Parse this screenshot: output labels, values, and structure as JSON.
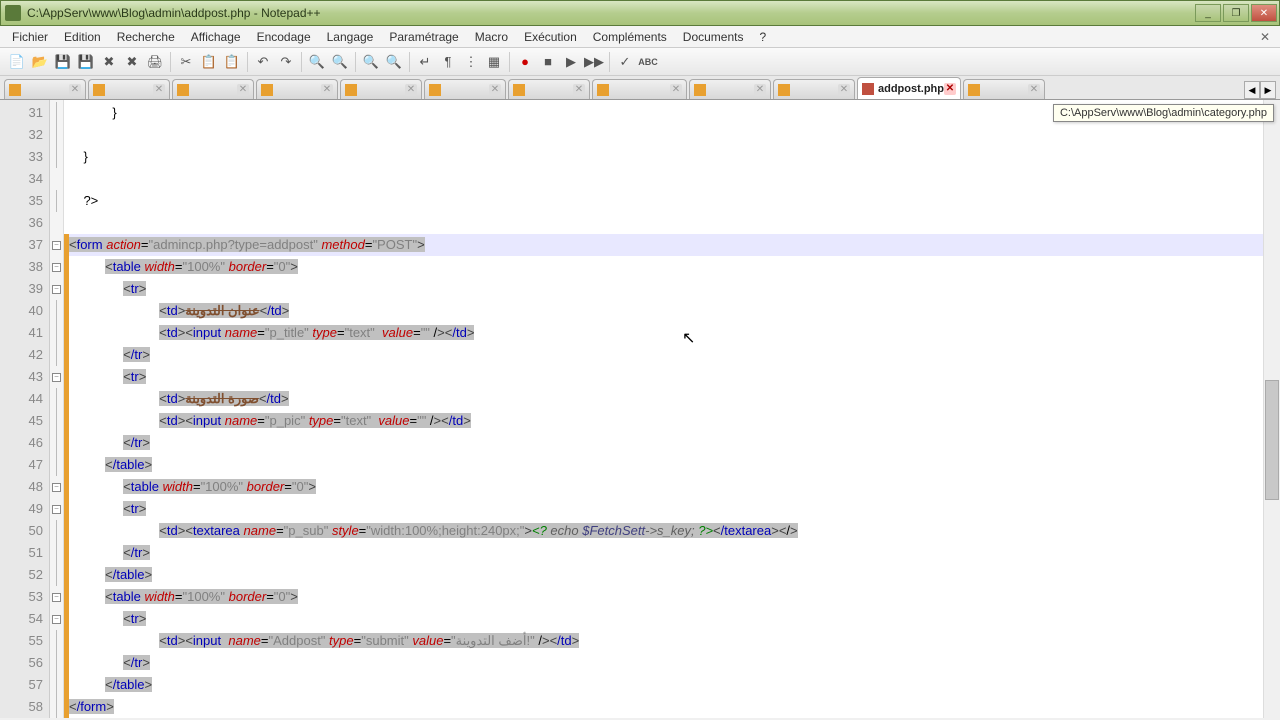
{
  "window": {
    "title": "C:\\AppServ\\www\\Blog\\admin\\addpost.php - Notepad++"
  },
  "menu": {
    "items": [
      "Fichier",
      "Edition",
      "Recherche",
      "Affichage",
      "Encodage",
      "Langage",
      "Paramétrage",
      "Macro",
      "Exécution",
      "Compléments",
      "Documents",
      "?"
    ]
  },
  "toolbar_icons": [
    "new",
    "open",
    "save",
    "saveall",
    "close",
    "closeall",
    "print",
    "|",
    "cut",
    "copy",
    "paste",
    "|",
    "undo",
    "redo",
    "|",
    "find",
    "replace",
    "|",
    "zoomin",
    "zoomout",
    "|",
    "ws1",
    "ws2",
    "ws3",
    "ws4",
    "|",
    "indent",
    "outdent",
    "|",
    "rec",
    "stop",
    "play",
    "playmul",
    "|",
    "spell",
    "abc"
  ],
  "tabs": [
    {
      "label": "",
      "active": false
    },
    {
      "label": "",
      "active": false
    },
    {
      "label": "",
      "active": false
    },
    {
      "label": "",
      "active": false
    },
    {
      "label": "",
      "active": false
    },
    {
      "label": "",
      "active": false
    },
    {
      "label": "",
      "active": false
    },
    {
      "label": "",
      "active": false
    },
    {
      "label": "",
      "active": false
    },
    {
      "label": "",
      "active": false
    },
    {
      "label": "addpost.php",
      "active": true,
      "modified": true
    },
    {
      "label": "",
      "active": false
    }
  ],
  "tooltip": "C:\\AppServ\\www\\Blog\\admin\\category.php",
  "first_line_number": 31,
  "line_count": 28,
  "code_lines": [
    {
      "n": 31,
      "fold": "l",
      "ch": "",
      "html": "            }"
    },
    {
      "n": 32,
      "fold": "l",
      "ch": "",
      "html": ""
    },
    {
      "n": 33,
      "fold": "e",
      "ch": "",
      "html": "    }"
    },
    {
      "n": 34,
      "fold": "",
      "ch": "",
      "html": ""
    },
    {
      "n": 35,
      "fold": "e",
      "ch": "",
      "html": "    ?>"
    },
    {
      "n": 36,
      "fold": "",
      "ch": "",
      "html": ""
    },
    {
      "n": 37,
      "fold": "b",
      "ch": "m",
      "sel": true,
      "cur": true,
      "html": "<form action=\"admincp.php?type=addpost\" method=\"POST\">"
    },
    {
      "n": 38,
      "fold": "b",
      "ch": "m",
      "sel": true,
      "html": "          <table width=\"100%\" border=\"0\">"
    },
    {
      "n": 39,
      "fold": "b",
      "ch": "m",
      "sel": true,
      "html": "               <tr>"
    },
    {
      "n": 40,
      "fold": "l",
      "ch": "m",
      "sel": true,
      "html": "                         <td>عنوان التدوينة</td>"
    },
    {
      "n": 41,
      "fold": "l",
      "ch": "m",
      "sel": true,
      "html": "                         <td><input name=\"p_title\" type=\"text\"  value=\"\" /></td>"
    },
    {
      "n": 42,
      "fold": "e",
      "ch": "m",
      "sel": true,
      "html": "               </tr>"
    },
    {
      "n": 43,
      "fold": "b",
      "ch": "m",
      "sel": true,
      "html": "               <tr>"
    },
    {
      "n": 44,
      "fold": "l",
      "ch": "m",
      "sel": true,
      "html": "                         <td>صورة التدوينة</td>"
    },
    {
      "n": 45,
      "fold": "l",
      "ch": "m",
      "sel": true,
      "html": "                         <td><input name=\"p_pic\" type=\"text\"  value=\"\" /></td>"
    },
    {
      "n": 46,
      "fold": "e",
      "ch": "m",
      "sel": true,
      "html": "               </tr>"
    },
    {
      "n": 47,
      "fold": "e",
      "ch": "m",
      "sel": true,
      "html": "          </table>"
    },
    {
      "n": 48,
      "fold": "b",
      "ch": "m",
      "sel": true,
      "html": "               <table width=\"100%\" border=\"0\">"
    },
    {
      "n": 49,
      "fold": "b",
      "ch": "m",
      "sel": true,
      "html": "               <tr>"
    },
    {
      "n": 50,
      "fold": "l",
      "ch": "m",
      "sel": true,
      "html": "                         <td><textarea name=\"p_sub\" style=\"width:100%;height:240px;\"><? echo $FetchSett->s_key; ?></textarea></t"
    },
    {
      "n": 51,
      "fold": "e",
      "ch": "m",
      "sel": true,
      "html": "               </tr>"
    },
    {
      "n": 52,
      "fold": "e",
      "ch": "m",
      "sel": true,
      "html": "          </table>"
    },
    {
      "n": 53,
      "fold": "b",
      "ch": "m",
      "sel": true,
      "html": "          <table width=\"100%\" border=\"0\">"
    },
    {
      "n": 54,
      "fold": "b",
      "ch": "m",
      "sel": true,
      "html": "               <tr>"
    },
    {
      "n": 55,
      "fold": "l",
      "ch": "m",
      "sel": true,
      "html": "                         <td><input  name=\"Addpost\" type=\"submit\" value=\"أضف التدوينة!\" /></td>"
    },
    {
      "n": 56,
      "fold": "e",
      "ch": "m",
      "sel": true,
      "html": "               </tr>"
    },
    {
      "n": 57,
      "fold": "e",
      "ch": "m",
      "sel": true,
      "html": "          </table>"
    },
    {
      "n": 58,
      "fold": "e",
      "ch": "m",
      "sel": true,
      "html": "</form>"
    }
  ]
}
